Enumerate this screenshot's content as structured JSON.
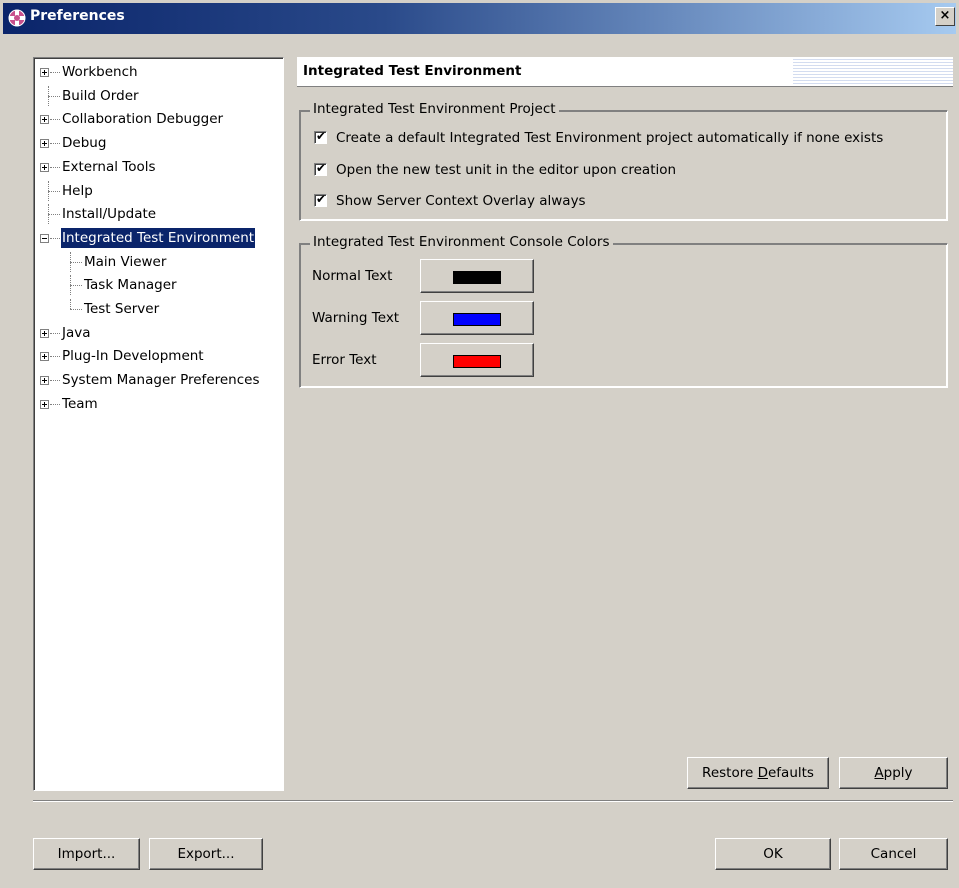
{
  "window": {
    "title": "Preferences",
    "close_glyph": "×",
    "icon": "eclipse-app-icon"
  },
  "tree": {
    "items": [
      {
        "label": "Workbench",
        "level": 0,
        "expander": "plus"
      },
      {
        "label": "Build Order",
        "level": 0,
        "expander": "none"
      },
      {
        "label": "Collaboration Debugger",
        "level": 0,
        "expander": "plus"
      },
      {
        "label": "Debug",
        "level": 0,
        "expander": "plus"
      },
      {
        "label": "External Tools",
        "level": 0,
        "expander": "plus"
      },
      {
        "label": "Help",
        "level": 0,
        "expander": "none"
      },
      {
        "label": "Install/Update",
        "level": 0,
        "expander": "none"
      },
      {
        "label": "Integrated Test Environment",
        "level": 0,
        "expander": "minus",
        "selected": true
      },
      {
        "label": "Main Viewer",
        "level": 1,
        "expander": "none"
      },
      {
        "label": "Task Manager",
        "level": 1,
        "expander": "none"
      },
      {
        "label": "Test Server",
        "level": 1,
        "expander": "none"
      },
      {
        "label": "Java",
        "level": 0,
        "expander": "plus"
      },
      {
        "label": "Plug-In Development",
        "level": 0,
        "expander": "plus"
      },
      {
        "label": "System Manager Preferences",
        "level": 0,
        "expander": "plus"
      },
      {
        "label": "Team",
        "level": 0,
        "expander": "plus"
      }
    ]
  },
  "page": {
    "title": "Integrated Test Environment"
  },
  "project_group": {
    "legend": "Integrated Test Environment Project",
    "options": [
      {
        "label": "Create a default Integrated Test Environment project automatically if none exists",
        "checked": true
      },
      {
        "label": "Open the new test unit in the editor upon creation",
        "checked": true
      },
      {
        "label": "Show Server Context Overlay always",
        "checked": true
      }
    ]
  },
  "colors_group": {
    "legend": "Integrated Test Environment Console Colors",
    "rows": [
      {
        "label": "Normal Text",
        "color": "#000000"
      },
      {
        "label": "Warning Text",
        "color": "#0000ff"
      },
      {
        "label": "Error Text",
        "color": "#ff0000"
      }
    ]
  },
  "buttons": {
    "restore_defaults_pre": "Restore ",
    "restore_defaults_mnemonic": "D",
    "restore_defaults_post": "efaults",
    "apply_mnemonic": "A",
    "apply_post": "pply",
    "import": "Import...",
    "export": "Export...",
    "ok": "OK",
    "cancel": "Cancel"
  }
}
